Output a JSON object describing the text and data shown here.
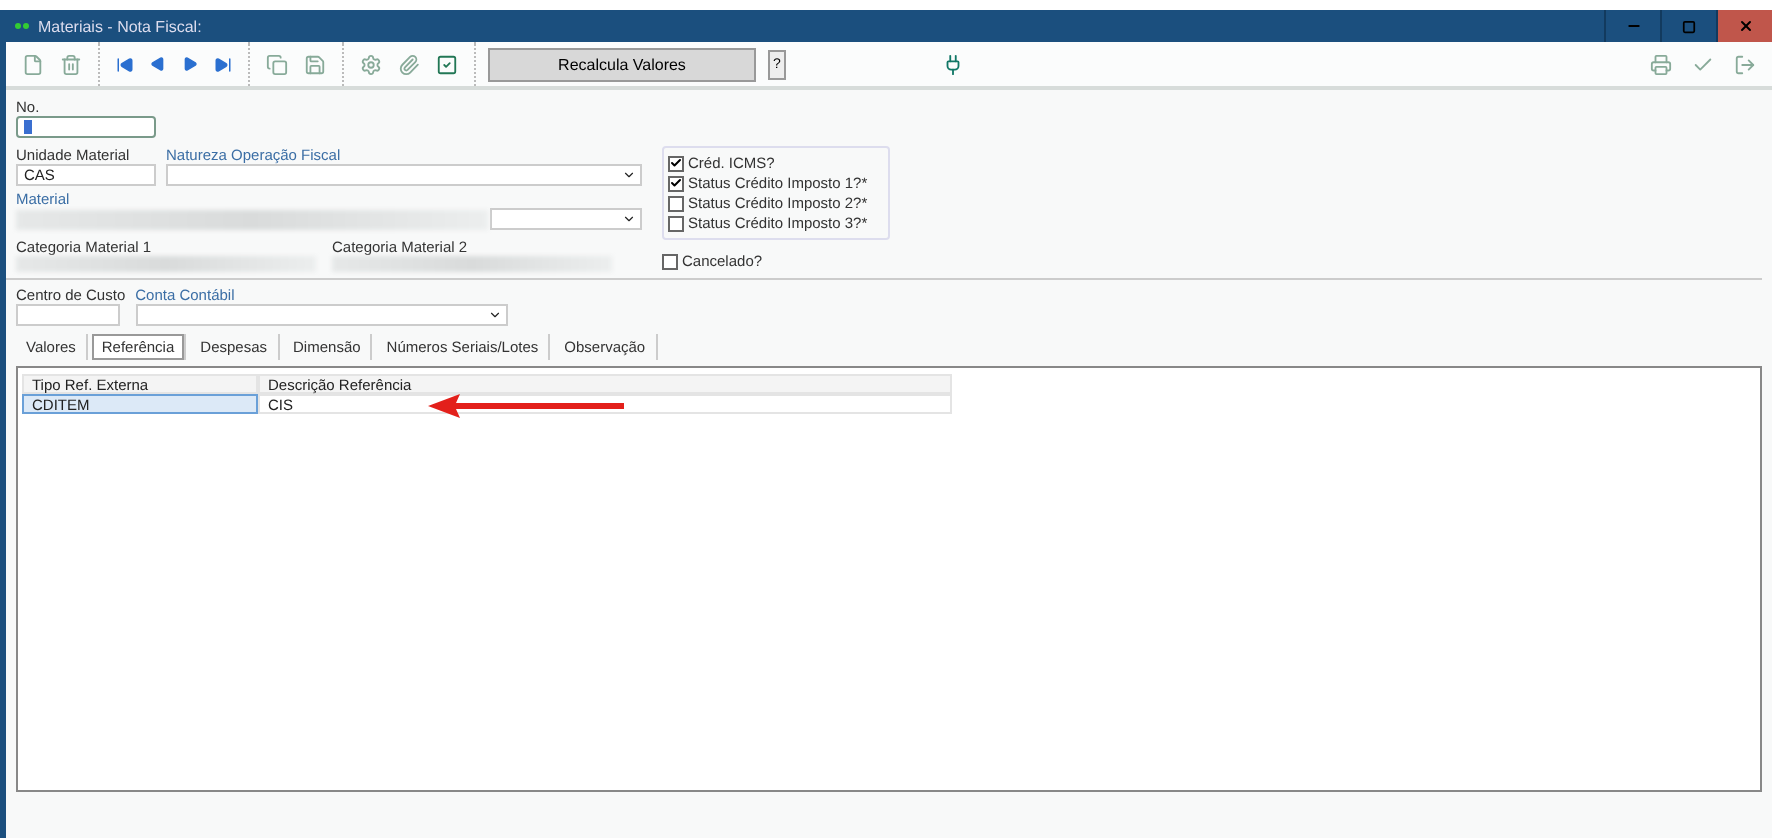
{
  "window": {
    "title": "Materiais - Nota Fiscal:"
  },
  "toolbar": {
    "recalc_button": "Recalcula Valores",
    "help_button": "?"
  },
  "fields": {
    "number_label": "No.",
    "unit_label": "Unidade Material",
    "unit_value": "CAS",
    "nature_label": "Natureza Operação Fiscal",
    "material_label": "Material",
    "category1_label": "Categoria Material 1",
    "category2_label": "Categoria Material 2",
    "cost_center_label": "Centro de Custo",
    "account_label": "Conta Contábil"
  },
  "checkboxes": [
    {
      "label": "Créd. ICMS?",
      "checked": true
    },
    {
      "label": "Status Crédito Imposto 1?*",
      "checked": true
    },
    {
      "label": "Status Crédito Imposto 2?*",
      "checked": false
    },
    {
      "label": "Status Crédito Imposto 3?*",
      "checked": false
    }
  ],
  "cancelled": {
    "label": "Cancelado?",
    "checked": false
  },
  "tabs": [
    {
      "label": "Valores",
      "selected": false
    },
    {
      "label": "Referência",
      "selected": true
    },
    {
      "label": "Despesas",
      "selected": false
    },
    {
      "label": "Dimensão",
      "selected": false
    },
    {
      "label": "Números Seriais/Lotes",
      "selected": false
    },
    {
      "label": "Observação",
      "selected": false
    }
  ],
  "table": {
    "columns": [
      "Tipo Ref. Externa",
      "Descrição Referência"
    ],
    "rows": [
      {
        "selected": true,
        "cells": [
          "CDITEM",
          "CIS"
        ]
      }
    ]
  }
}
